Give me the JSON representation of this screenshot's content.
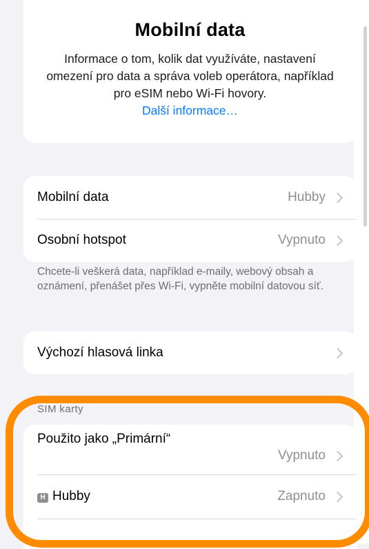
{
  "header": {
    "title": "Mobilní data",
    "description": "Informace o tom, kolik dat využíváte, nastavení omezení pro data a správa voleb operátora, například pro eSIM nebo Wi‑Fi hovory.",
    "link": "Další informace…"
  },
  "group1": {
    "rows": [
      {
        "label": "Mobilní data",
        "value": "Hubby"
      },
      {
        "label": "Osobní hotspot",
        "value": "Vypnuto"
      }
    ],
    "footnote": "Chcete-li veškerá data, například e-maily, webový obsah a oznámení, přenášet přes Wi‑Fi, vypněte mobilní datovou síť."
  },
  "group2": {
    "rows": [
      {
        "label": "Výchozí hlasová linka",
        "value": ""
      }
    ]
  },
  "sim_section": {
    "header": "SIM karty",
    "rows": [
      {
        "label": "Použito jako „Primární“",
        "value": "Vypnuto"
      },
      {
        "badge": "H",
        "label": "Hubby",
        "value": "Zapnuto"
      }
    ]
  },
  "colors": {
    "accent": "#0a7aff",
    "highlight": "#ff8c00"
  }
}
